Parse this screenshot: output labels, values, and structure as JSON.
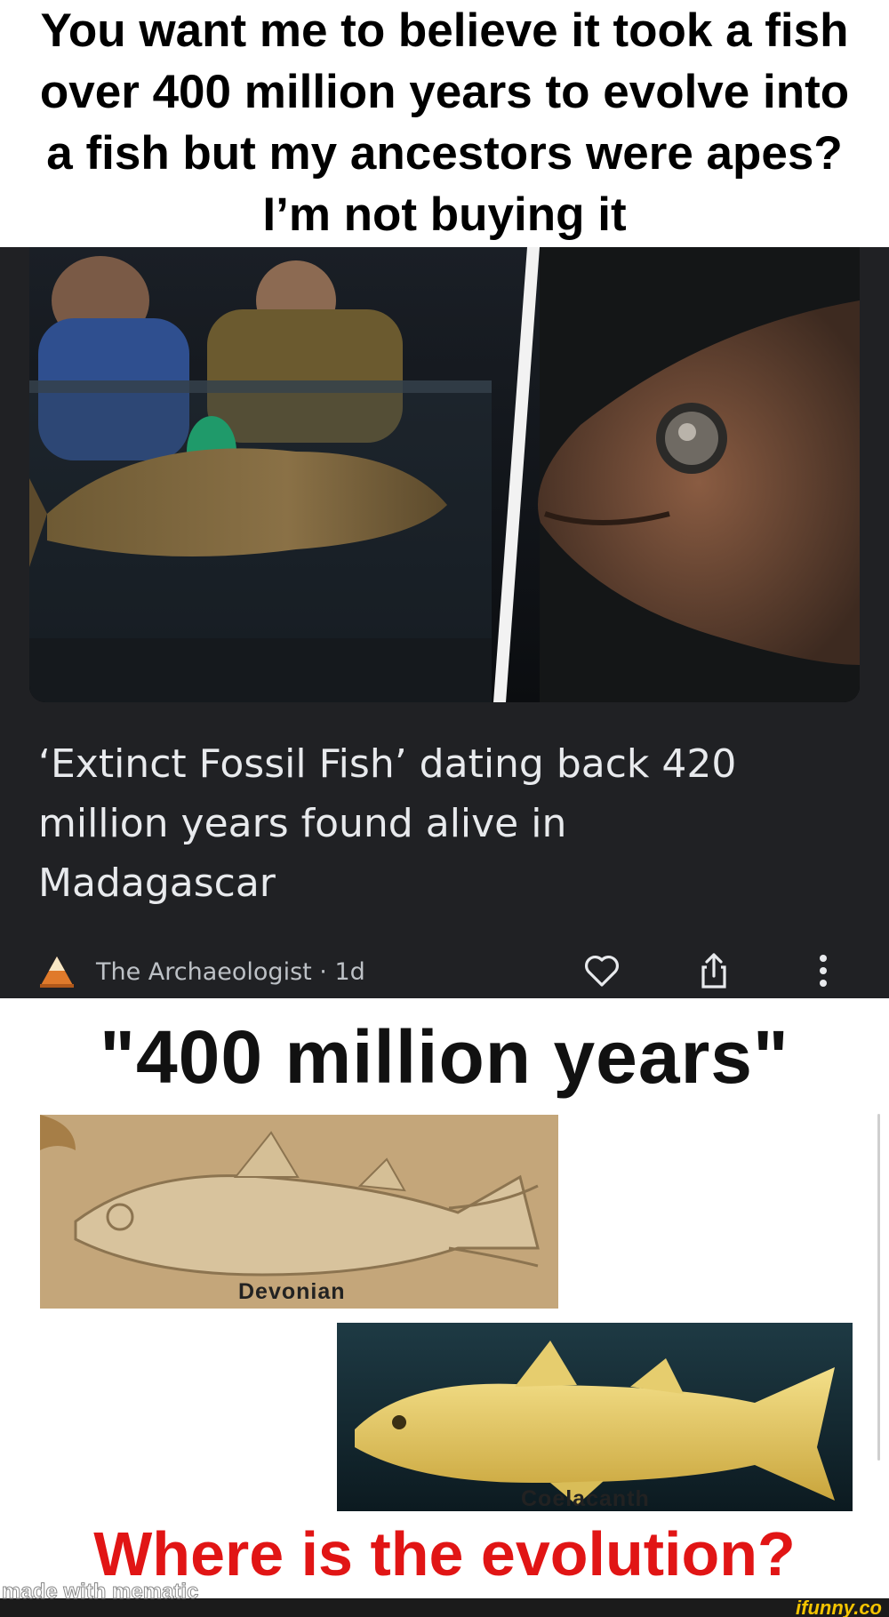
{
  "caption": {
    "lines": [
      "You want me to believe it took a fish",
      "over 400 million years to evolve into",
      "a fish but my ancestors were apes?",
      "I’m not buying it"
    ]
  },
  "news_card": {
    "headline_lines": [
      "‘Extinct Fossil Fish’ dating back 420",
      "million years found alive in",
      "Madagascar"
    ],
    "source": "The Archaeologist · 1d",
    "icons": [
      "logo-icon",
      "heart-icon",
      "share-icon",
      "more-icon"
    ]
  },
  "meme": {
    "title": "\"400 million years\"",
    "fossil_label": "Devonian",
    "fish_label": "Coelacanth",
    "question": "Where is the evolution?"
  },
  "watermarks": {
    "left": "made with mematic",
    "right": "ifunny.co"
  },
  "colors": {
    "card_bg": "#202124",
    "headline": "#e8eaed",
    "question": "#e11515"
  }
}
